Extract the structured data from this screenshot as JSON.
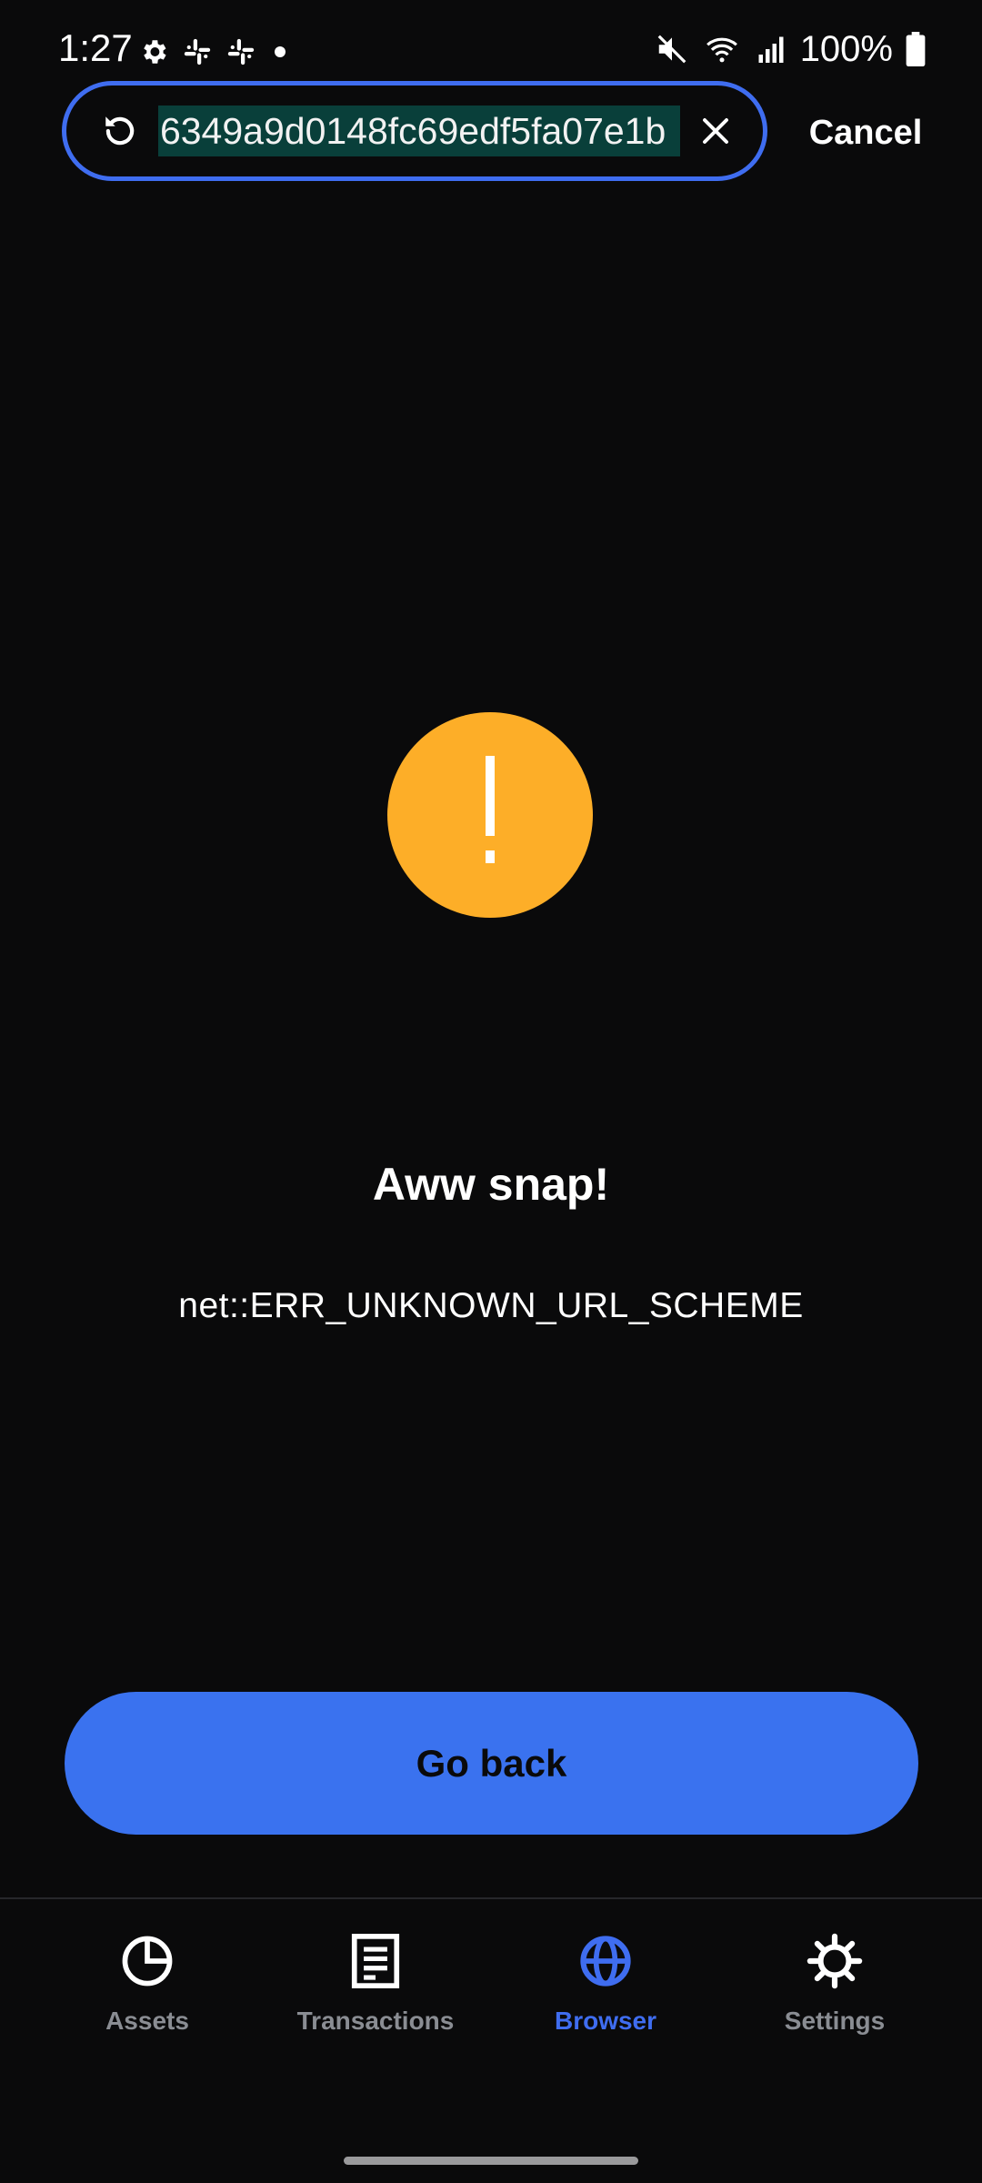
{
  "status_bar": {
    "time": "1:27",
    "battery": "100%",
    "left_icons": [
      "gear-icon",
      "slack-icon",
      "slack-icon",
      "dot-icon"
    ],
    "right_icons": [
      "mute-icon",
      "wifi-icon",
      "signal-icon",
      "battery-icon"
    ]
  },
  "url_bar": {
    "value": "6349a9d0148fc69edf5fa07e1b",
    "cancel_label": "Cancel",
    "focus_color": "#3f6df0"
  },
  "error": {
    "title": "Aww snap!",
    "message": "net::ERR_UNKNOWN_URL_SCHEME",
    "icon": "exclamation-icon",
    "icon_color": "#fdae28"
  },
  "actions": {
    "go_back_label": "Go back",
    "button_color": "#3a72ef"
  },
  "bottom_nav": {
    "items": [
      {
        "label": "Assets",
        "icon": "pie-chart-icon",
        "active": false
      },
      {
        "label": "Transactions",
        "icon": "document-icon",
        "active": false
      },
      {
        "label": "Browser",
        "icon": "globe-icon",
        "active": true
      },
      {
        "label": "Settings",
        "icon": "gear-icon",
        "active": false
      }
    ],
    "active_color": "#3f6df0",
    "inactive_color": "#8a8d93"
  }
}
